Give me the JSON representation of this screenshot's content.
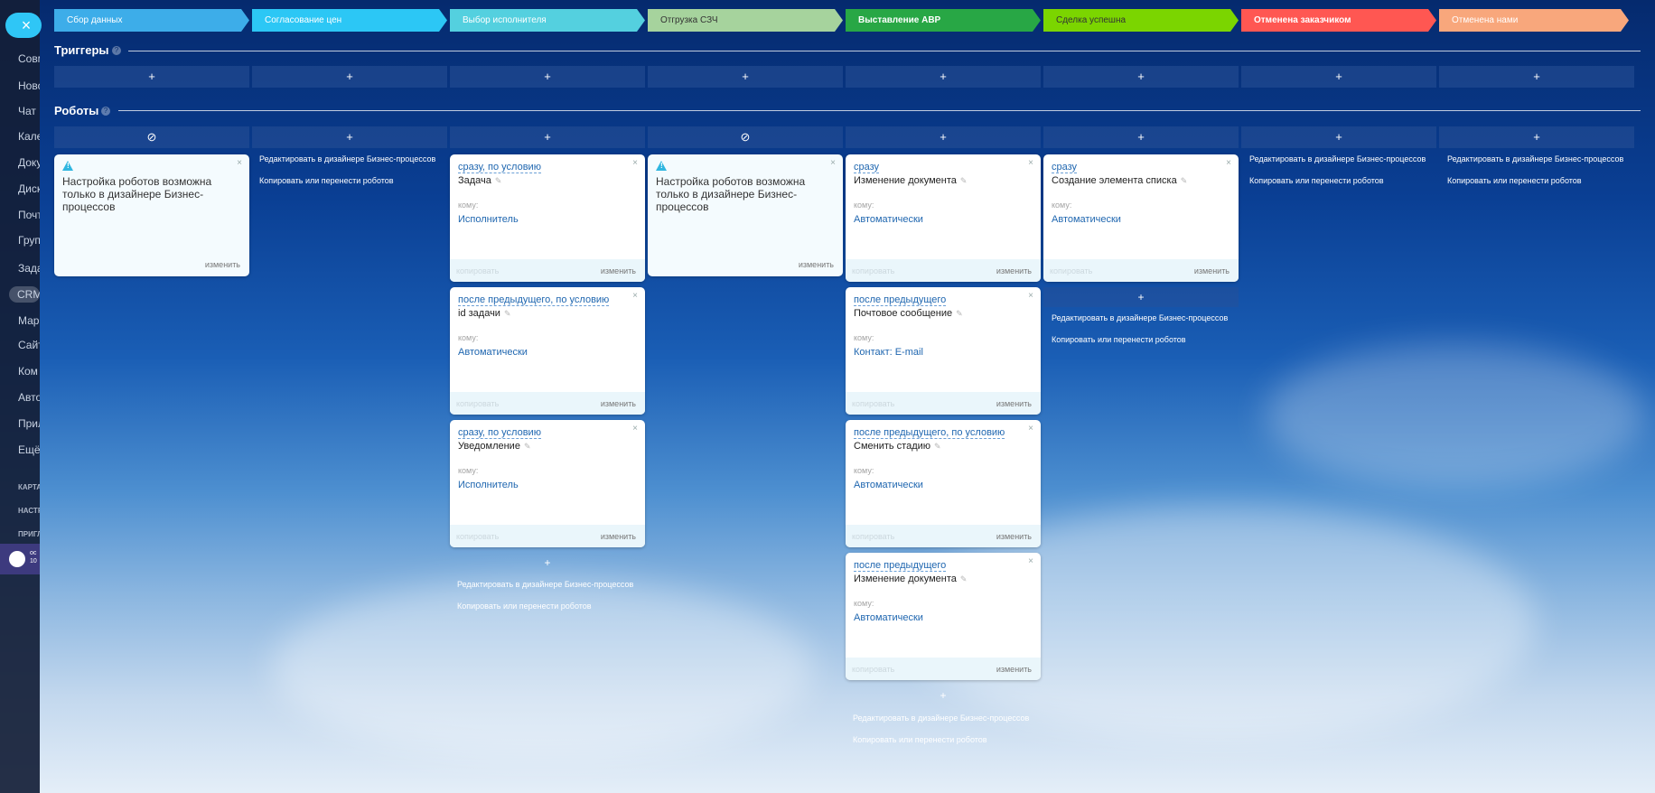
{
  "sidebar": {
    "close_label": "×",
    "items": [
      "Совм",
      "Новс",
      "Чат и",
      "Кале",
      "Доку",
      "Диск",
      "Почт",
      "Груп",
      "Зада",
      "CRM",
      "Мар",
      "Сайт",
      "Ком",
      "Авто",
      "Прил",
      "Ещё"
    ],
    "small_items": [
      "КАРТА",
      "НАСТР",
      "ПРИГЛ"
    ],
    "avatar_text": "ос 10"
  },
  "stages": [
    {
      "label": "Сбор данных",
      "color": "#3dade9",
      "text_color": "#ffffff"
    },
    {
      "label": "Согласование цен",
      "color": "#2cc7f5",
      "text_color": "#ffffff"
    },
    {
      "label": "Выбор исполнителя",
      "color": "#54d0df",
      "text_color": "#ffffff"
    },
    {
      "label": "Отгрузка СЗЧ",
      "color": "#a6d39d",
      "text_color": "#333333"
    },
    {
      "label": "Выставление АВР",
      "color": "#28a745",
      "text_color": "#ffffff"
    },
    {
      "label": "Сделка успешна",
      "color": "#7bd500",
      "text_color": "#333333"
    },
    {
      "label": "Отменена заказчиком",
      "color": "#ff5752",
      "text_color": "#ffffff"
    },
    {
      "label": "Отменена нами",
      "color": "#f8a77c",
      "text_color": "#ffffff"
    }
  ],
  "triggers_title": "Триггеры",
  "robots_title": "Роботы",
  "help": "?",
  "add_symbol": "+",
  "disabled_symbol": "⊘",
  "robot_buttons": [
    "⊘",
    "+",
    "+",
    "⊘",
    "+",
    "+",
    "+",
    "+"
  ],
  "warning_text": "Настройка роботов возможна только в дизайнере Бизнес-процессов",
  "edit_label": "изменить",
  "copy_label": "копировать",
  "to_label": "кому:",
  "pencil": "✎",
  "close": "×",
  "link_edit_designer": "Редактировать в дизайнере Бизнес-процессов",
  "link_copy_move": "Копировать или перенести роботов",
  "robots": {
    "col3": [
      {
        "cond": "сразу, по условию",
        "name": "Задача",
        "to": "Исполнитель"
      },
      {
        "cond": "после предыдущего, по условию",
        "name": "id задачи",
        "to": "Автоматически"
      },
      {
        "cond": "сразу, по условию",
        "name": "Уведомление",
        "to": "Исполнитель"
      }
    ],
    "col5": [
      {
        "cond": "сразу",
        "name": "Изменение документа",
        "to": "Автоматически"
      },
      {
        "cond": "после предыдущего",
        "name": "Почтовое сообщение",
        "to": "Контакт: E-mail"
      },
      {
        "cond": "после предыдущего, по условию",
        "name": "Сменить стадию",
        "to": "Автоматически"
      },
      {
        "cond": "после предыдущего",
        "name": "Изменение документа",
        "to": "Автоматически"
      }
    ],
    "col6": [
      {
        "cond": "сразу",
        "name": "Создание элемента списка",
        "to": "Автоматически"
      }
    ]
  }
}
